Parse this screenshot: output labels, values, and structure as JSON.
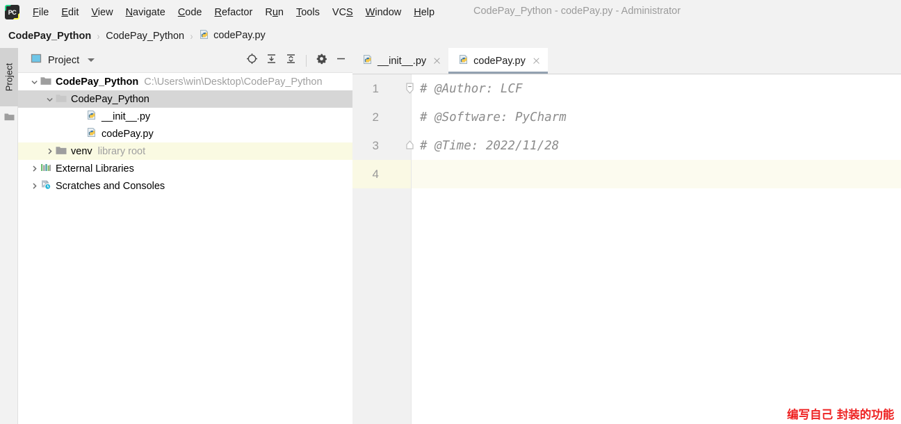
{
  "window": {
    "title": "CodePay_Python - codePay.py - Administrator",
    "logo_text": "PC",
    "logo_name": "pycharm-logo-icon"
  },
  "menubar": {
    "items": [
      {
        "label": "File",
        "mnemonic": "F",
        "rest": "ile"
      },
      {
        "label": "Edit",
        "mnemonic": "E",
        "rest": "dit"
      },
      {
        "label": "View",
        "mnemonic": "V",
        "rest": "iew"
      },
      {
        "label": "Navigate",
        "pre": "",
        "mnemonic": "N",
        "rest": "avigate"
      },
      {
        "label": "Code",
        "mnemonic": "C",
        "rest": "ode"
      },
      {
        "label": "Refactor",
        "mnemonic": "R",
        "rest": "efactor"
      },
      {
        "label": "Run",
        "pre": "R",
        "mnemonic": "u",
        "rest": "n"
      },
      {
        "label": "Tools",
        "mnemonic": "T",
        "rest": "ools"
      },
      {
        "label": "VCS",
        "pre": "VC",
        "mnemonic": "S",
        "rest": ""
      },
      {
        "label": "Window",
        "mnemonic": "W",
        "rest": "indow"
      },
      {
        "label": "Help",
        "mnemonic": "H",
        "rest": "elp"
      }
    ]
  },
  "breadcrumb": {
    "separator": "›",
    "items": [
      {
        "label": "CodePay_Python",
        "bold": true,
        "icon": ""
      },
      {
        "label": "CodePay_Python",
        "bold": false,
        "icon": ""
      },
      {
        "label": "codePay.py",
        "bold": false,
        "icon": "python-file-icon"
      }
    ]
  },
  "toolstrip": {
    "tab_label": "Project",
    "folder_icon": "folder-icon"
  },
  "project_panel": {
    "header": {
      "title": "Project",
      "panel_icon": "project-view-icon",
      "dropdown_icon": "chevron-down-icon",
      "tools": [
        {
          "name": "locate-icon",
          "title": "Select Opened File"
        },
        {
          "name": "expand-all-icon",
          "title": "Expand All"
        },
        {
          "name": "collapse-all-icon",
          "title": "Collapse All"
        },
        {
          "name": "gear-icon",
          "title": "Settings"
        },
        {
          "name": "minimize-icon",
          "title": "Hide"
        }
      ]
    },
    "tree": [
      {
        "label": "CodePay_Python",
        "sub": "C:\\Users\\win\\Desktop\\CodePay_Python",
        "indent": 14,
        "twisty": "down",
        "icon": "folder-icon",
        "bold": true,
        "state": "normal"
      },
      {
        "label": "CodePay_Python",
        "sub": "",
        "indent": 36,
        "twisty": "down",
        "icon": "source-root-folder-icon",
        "bold": false,
        "state": "selected"
      },
      {
        "label": "__init__.py",
        "sub": "",
        "indent": 80,
        "twisty": "none",
        "icon": "python-file-icon",
        "bold": false,
        "state": "normal"
      },
      {
        "label": "codePay.py",
        "sub": "",
        "indent": 80,
        "twisty": "none",
        "icon": "python-file-icon",
        "bold": false,
        "state": "normal"
      },
      {
        "label": "venv",
        "sub": "library root",
        "indent": 36,
        "twisty": "right",
        "icon": "folder-icon",
        "bold": false,
        "state": "library-root"
      },
      {
        "label": "External Libraries",
        "sub": "",
        "indent": 14,
        "twisty": "right",
        "icon": "external-libraries-icon",
        "bold": false,
        "state": "normal"
      },
      {
        "label": "Scratches and Consoles",
        "sub": "",
        "indent": 14,
        "twisty": "right",
        "icon": "scratches-icon",
        "bold": false,
        "state": "normal"
      }
    ]
  },
  "editor": {
    "tabs": [
      {
        "label": "__init__.py",
        "icon": "python-file-icon",
        "active": false
      },
      {
        "label": "codePay.py",
        "icon": "python-file-icon",
        "active": true
      }
    ],
    "lines": [
      {
        "num": "1",
        "text": "# @Author: LCF",
        "fold": "start",
        "caret": false
      },
      {
        "num": "2",
        "text": "# @Software: PyCharm",
        "fold": "none",
        "caret": false
      },
      {
        "num": "3",
        "text": "# @Time: 2022/11/28",
        "fold": "end",
        "caret": false
      },
      {
        "num": "4",
        "text": "",
        "fold": "none",
        "caret": true
      }
    ],
    "annotation": "编写自己 封装的功能"
  },
  "colors": {
    "accent_red": "#ee2222",
    "active_tab_underline": "#93a1b0",
    "selection_gray": "#d6d6d6",
    "library_root_yellow": "#fafae2",
    "caret_line": "#fcfbef",
    "comment_gray": "#8c8c8c"
  }
}
